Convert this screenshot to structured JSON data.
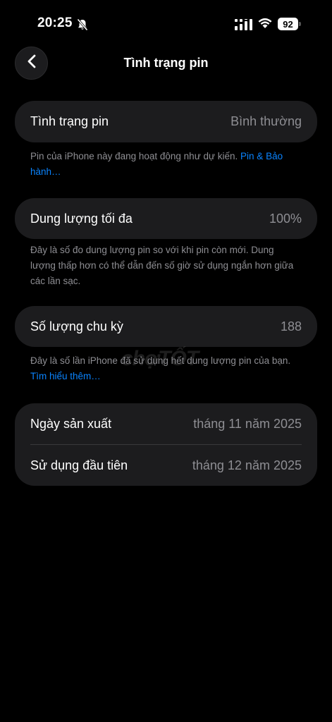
{
  "status": {
    "time": "20:25",
    "battery": "92"
  },
  "nav": {
    "title": "Tình trạng pin"
  },
  "health": {
    "label": "Tình trạng pin",
    "value": "Bình thường",
    "note_text": "Pin của iPhone này đang hoạt động như dự kiến. ",
    "note_link": "Pin & Bảo hành…"
  },
  "capacity": {
    "label": "Dung lượng tối đa",
    "value": "100%",
    "note": "Đây là số đo dung lượng pin so với khi pin còn mới. Dung lượng thấp hơn có thể dẫn đến số giờ sử dụng ngắn hơn giữa các lần sạc."
  },
  "cycles": {
    "label": "Số lượng chu kỳ",
    "value": "188",
    "note_text": "Đây là số lần iPhone đã sử dụng hết dung lượng pin của bạn. ",
    "note_link": "Tìm hiểu thêm…"
  },
  "dates": {
    "manufacture_label": "Ngày sản xuất",
    "manufacture_value": "tháng 11 năm 2025",
    "first_use_label": "Sử dụng đầu tiên",
    "first_use_value": "tháng 12 năm 2025"
  },
  "watermark": "chợTỐT"
}
